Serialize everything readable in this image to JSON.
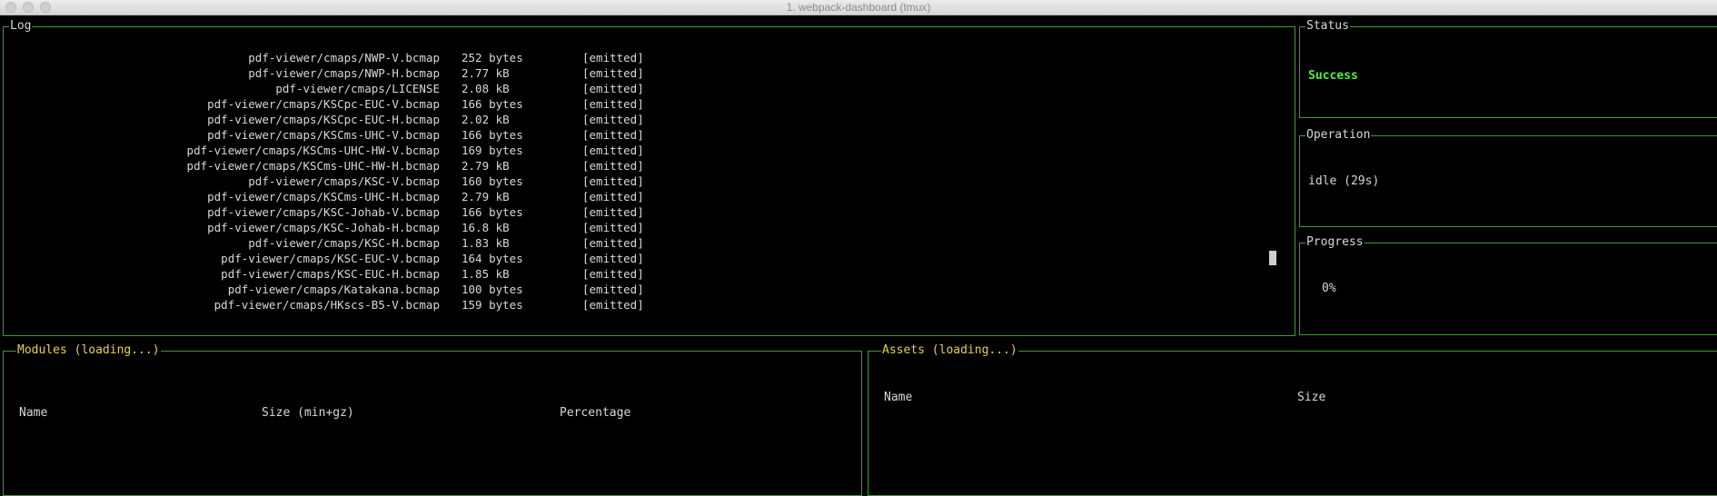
{
  "window": {
    "title": "1. webpack-dashboard (tmux)"
  },
  "log": {
    "title": "Log",
    "rows": [
      {
        "name": "pdf-viewer/cmaps/NWP-V.bcmap",
        "size": "252 bytes",
        "status": "[emitted]"
      },
      {
        "name": "pdf-viewer/cmaps/NWP-H.bcmap",
        "size": "2.77 kB",
        "status": "[emitted]"
      },
      {
        "name": "pdf-viewer/cmaps/LICENSE",
        "size": "2.08 kB",
        "status": "[emitted]"
      },
      {
        "name": "pdf-viewer/cmaps/KSCpc-EUC-V.bcmap",
        "size": "166 bytes",
        "status": "[emitted]"
      },
      {
        "name": "pdf-viewer/cmaps/KSCpc-EUC-H.bcmap",
        "size": "2.02 kB",
        "status": "[emitted]"
      },
      {
        "name": "pdf-viewer/cmaps/KSCms-UHC-V.bcmap",
        "size": "166 bytes",
        "status": "[emitted]"
      },
      {
        "name": "pdf-viewer/cmaps/KSCms-UHC-HW-V.bcmap",
        "size": "169 bytes",
        "status": "[emitted]"
      },
      {
        "name": "pdf-viewer/cmaps/KSCms-UHC-HW-H.bcmap",
        "size": "2.79 kB",
        "status": "[emitted]"
      },
      {
        "name": "pdf-viewer/cmaps/KSC-V.bcmap",
        "size": "160 bytes",
        "status": "[emitted]"
      },
      {
        "name": "pdf-viewer/cmaps/KSCms-UHC-H.bcmap",
        "size": "2.79 kB",
        "status": "[emitted]"
      },
      {
        "name": "pdf-viewer/cmaps/KSC-Johab-V.bcmap",
        "size": "166 bytes",
        "status": "[emitted]"
      },
      {
        "name": "pdf-viewer/cmaps/KSC-Johab-H.bcmap",
        "size": "16.8 kB",
        "status": "[emitted]"
      },
      {
        "name": "pdf-viewer/cmaps/KSC-H.bcmap",
        "size": "1.83 kB",
        "status": "[emitted]"
      },
      {
        "name": "pdf-viewer/cmaps/KSC-EUC-V.bcmap",
        "size": "164 bytes",
        "status": "[emitted]"
      },
      {
        "name": "pdf-viewer/cmaps/KSC-EUC-H.bcmap",
        "size": "1.85 kB",
        "status": "[emitted]"
      },
      {
        "name": "pdf-viewer/cmaps/Katakana.bcmap",
        "size": "100 bytes",
        "status": "[emitted]"
      },
      {
        "name": "pdf-viewer/cmaps/HKscs-B5-V.bcmap",
        "size": "159 bytes",
        "status": "[emitted]"
      }
    ]
  },
  "status": {
    "title": "Status",
    "value": "Success",
    "color": "#52f23a"
  },
  "operation": {
    "title": "Operation",
    "value": "idle (29s)"
  },
  "progress": {
    "title": "Progress",
    "value": "0%",
    "fraction": 0
  },
  "modules": {
    "title": "Modules (loading...)",
    "columns": [
      "Name",
      "Size (min+gz)",
      "Percentage"
    ]
  },
  "assets": {
    "title": "Assets (loading...)",
    "columns": [
      "Name",
      "Size"
    ]
  },
  "colors": {
    "border": "#3d9e2a",
    "title_yellow": "#e8d04a",
    "text": "#d8d8d8"
  }
}
